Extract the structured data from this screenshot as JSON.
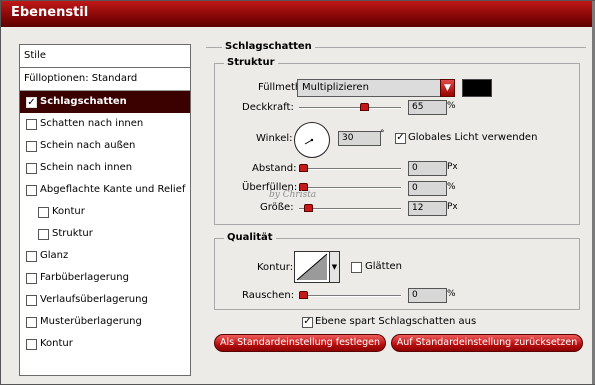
{
  "window": {
    "title": "Ebenenstil"
  },
  "left": {
    "header": "Stile",
    "fill_options": "Fülloptionen: Standard",
    "items": [
      {
        "label": "Schlagschatten",
        "checked": true,
        "selected": true,
        "indent": 0
      },
      {
        "label": "Schatten nach innen",
        "checked": false,
        "selected": false,
        "indent": 0
      },
      {
        "label": "Schein nach außen",
        "checked": false,
        "selected": false,
        "indent": 0
      },
      {
        "label": "Schein nach innen",
        "checked": false,
        "selected": false,
        "indent": 0
      },
      {
        "label": "Abgeflachte Kante und Relief",
        "checked": false,
        "selected": false,
        "indent": 0
      },
      {
        "label": "Kontur",
        "checked": false,
        "selected": false,
        "indent": 1
      },
      {
        "label": "Struktur",
        "checked": false,
        "selected": false,
        "indent": 1
      },
      {
        "label": "Glanz",
        "checked": false,
        "selected": false,
        "indent": 0
      },
      {
        "label": "Farbüberlagerung",
        "checked": false,
        "selected": false,
        "indent": 0
      },
      {
        "label": "Verlaufsüberlagerung",
        "checked": false,
        "selected": false,
        "indent": 0
      },
      {
        "label": "Musterüberlagerung",
        "checked": false,
        "selected": false,
        "indent": 0
      },
      {
        "label": "Kontur",
        "checked": false,
        "selected": false,
        "indent": 0
      }
    ]
  },
  "panel": {
    "section_title": "Schlagschatten",
    "structure": {
      "title": "Struktur",
      "blend_label": "Füllmethode:",
      "blend_value": "Multiplizieren",
      "shadow_color": "#000000",
      "opacity_label": "Deckkraft:",
      "opacity_value": "65",
      "opacity_unit": "%",
      "opacity_level": 0.65,
      "angle_label": "Winkel:",
      "angle_value": "30",
      "angle_unit": "°",
      "global_light_label": "Globales Licht verwenden",
      "global_light_checked": true,
      "distance_label": "Abstand:",
      "distance_value": "0",
      "distance_unit": "Px",
      "distance_level": 0,
      "spread_label": "Überfüllen:",
      "spread_value": "0",
      "spread_unit": "%",
      "spread_level": 0,
      "size_label": "Größe:",
      "size_value": "12",
      "size_unit": "Px",
      "size_level": 0.05
    },
    "quality": {
      "title": "Qualität",
      "contour_label": "Kontur:",
      "antialias_label": "Glätten",
      "antialias_checked": false,
      "noise_label": "Rauschen:",
      "noise_value": "0",
      "noise_unit": "%",
      "noise_level": 0
    },
    "knockout_label": "Ebene spart Schlagschatten aus",
    "knockout_checked": true,
    "btn_set_default": "Als Standardeinstellung festlegen",
    "btn_reset_default": "Auf Standardeinstellung zurücksetzen"
  },
  "watermark": "by Christa",
  "colors": {
    "title_bar": "#8a0808",
    "selected_row": "#3b0000",
    "accent": "#c61a1a"
  }
}
